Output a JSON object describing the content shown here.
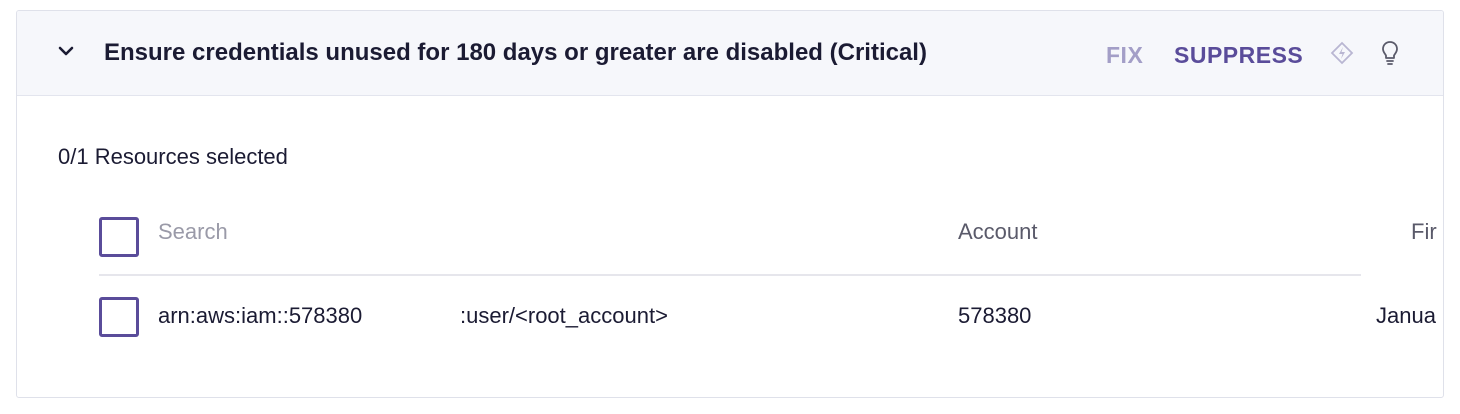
{
  "finding": {
    "title": "Ensure credentials unused for 180 days or greater are disabled (Critical)",
    "actions": {
      "fix_label": "FIX",
      "suppress_label": "SUPPRESS",
      "icons": [
        "diamond-icon",
        "lightbulb-icon"
      ]
    }
  },
  "resources": {
    "selected_count": "0/1 Resources selected",
    "search": {
      "placeholder": "Search",
      "value": ""
    },
    "columns": [
      "Account",
      "Fir"
    ],
    "rows": [
      {
        "arn_prefix": "arn:aws:iam::578380",
        "arn_suffix": ":user/<root_account>",
        "account": "578380",
        "first_seen": "Janua"
      }
    ]
  },
  "colors": {
    "accent": "#5a4c9a",
    "fix": "#a39ec7",
    "header_bg": "#f6f7fb",
    "text": "#1b1b33"
  }
}
